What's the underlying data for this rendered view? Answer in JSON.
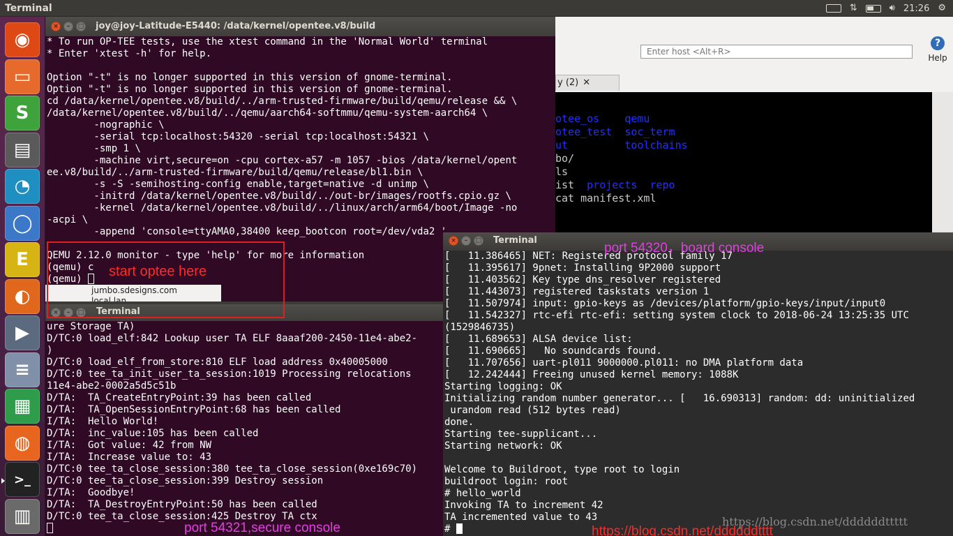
{
  "top_bar": {
    "title": "Terminal",
    "indicators": [
      "keyboard-icon",
      "network-icon",
      "battery-icon",
      "volume-icon"
    ],
    "clock": "21:26"
  },
  "launcher": {
    "items": [
      {
        "name": "ubuntu-dash-icon",
        "color": "#dd4814",
        "glyph": "◉"
      },
      {
        "name": "files-icon",
        "color": "#e66a2c",
        "glyph": "▭"
      },
      {
        "name": "sublime-editor-icon",
        "color": "#3fa33c",
        "glyph": "S"
      },
      {
        "name": "terminal-app-icon",
        "color": "#5a5a5a",
        "glyph": "▤"
      },
      {
        "name": "network-app-icon",
        "color": "#1e8fc0",
        "glyph": "◔"
      },
      {
        "name": "chromium-icon",
        "color": "#3b78c8",
        "glyph": "◯"
      },
      {
        "name": "editor-e-icon",
        "color": "#d6b414",
        "glyph": "E"
      },
      {
        "name": "software-app-icon",
        "color": "#e0681c",
        "glyph": "◐"
      },
      {
        "name": "video-app-icon",
        "color": "#5c6a80",
        "glyph": "▶"
      },
      {
        "name": "stack-app-icon",
        "color": "#8090a8",
        "glyph": "≡"
      },
      {
        "name": "spreadsheet-icon",
        "color": "#2e9c4a",
        "glyph": "▦"
      },
      {
        "name": "firefox-icon",
        "color": "#e86520",
        "glyph": "◍"
      },
      {
        "name": "terminal-icon",
        "color": "#222222",
        "glyph": ">_"
      },
      {
        "name": "workspace-icon",
        "color": "#6a6a6a",
        "glyph": "▥"
      }
    ]
  },
  "bg_window": {
    "host_placeholder": "Enter host <Alt+R>",
    "help_label": "Help",
    "tab_label": "y (2)",
    "terminal_lines": [
      [
        {
          "t": ""
        }
      ],
      [
        {
          "t": "otee_os    ",
          "c": "bl"
        },
        {
          "t": "qemu",
          "c": "bl"
        }
      ],
      [
        {
          "t": "otee_test  ",
          "c": "bl"
        },
        {
          "t": "soc_term",
          "c": "bl"
        }
      ],
      [
        {
          "t": "ut         ",
          "c": "bl"
        },
        {
          "t": "toolchains",
          "c": "bl"
        }
      ],
      [
        {
          "t": "bo/",
          "c": "gr"
        }
      ],
      [
        {
          "t": "ls",
          "c": "gr"
        }
      ],
      [
        {
          "t": "ist  ",
          "c": "gr"
        },
        {
          "t": "projects  ",
          "c": "bl"
        },
        {
          "t": "repo",
          "c": "bl"
        }
      ],
      [
        {
          "t": "cat manifest.xml",
          "c": "gr"
        }
      ]
    ]
  },
  "main_terminal": {
    "title": "joy@joy-Latitude-E5440: /data/kernel/opentee.v8/build",
    "lines": [
      "* To run OP-TEE tests, use the xtest command in the 'Normal World' terminal",
      "* Enter 'xtest -h' for help.",
      "",
      "Option \"-t\" is no longer supported in this version of gnome-terminal.",
      "Option \"-t\" is no longer supported in this version of gnome-terminal.",
      "cd /data/kernel/opentee.v8/build/../arm-trusted-firmware/build/qemu/release && \\",
      "/data/kernel/opentee.v8/build/../qemu/aarch64-softmmu/qemu-system-aarch64 \\",
      "        -nographic \\",
      "        -serial tcp:localhost:54320 -serial tcp:localhost:54321 \\",
      "        -smp 1 \\",
      "        -machine virt,secure=on -cpu cortex-a57 -m 1057 -bios /data/kernel/opent",
      "ee.v8/build/../arm-trusted-firmware/build/qemu/release/bl1.bin \\",
      "        -s -S -semihosting-config enable,target=native -d unimp \\",
      "        -initrd /data/kernel/opentee.v8/build/../out-br/images/rootfs.cpio.gz \\",
      "        -kernel /data/kernel/opentee.v8/build/../linux/arch/arm64/boot/Image -no",
      "-acpi \\",
      "        -append 'console=ttyAMA0,38400 keep_bootcon root=/dev/vda2 '",
      "",
      "QEMU 2.12.0 monitor - type 'help' for more information",
      "(qemu) c",
      "(qemu) "
    ]
  },
  "file_strip": {
    "items": [
      "jumbo.sdesigns.com",
      "local.lan"
    ]
  },
  "secure_terminal": {
    "title": "Terminal",
    "lines": [
      "ure Storage TA)",
      "D/TC:0 load_elf:842 Lookup user TA ELF 8aaaf200-2450-11e4-abe2-",
      ")",
      "D/TC:0 load_elf_from_store:810 ELF load address 0x40005000",
      "D/TC:0 tee_ta_init_user_ta_session:1019 Processing relocations",
      "11e4-abe2-0002a5d5c51b",
      "D/TA:  TA_CreateEntryPoint:39 has been called",
      "D/TA:  TA_OpenSessionEntryPoint:68 has been called",
      "I/TA:  Hello World!",
      "D/TA:  inc_value:105 has been called",
      "I/TA:  Got value: 42 from NW",
      "I/TA:  Increase value to: 43",
      "D/TC:0 tee_ta_close_session:380 tee_ta_close_session(0xe169c70)",
      "D/TC:0 tee_ta_close_session:399 Destroy session",
      "I/TA:  Goodbye!",
      "D/TA:  TA_DestroyEntryPoint:50 has been called",
      "D/TC:0 tee_ta_close_session:425 Destroy TA ctx"
    ]
  },
  "board_terminal": {
    "title": "Terminal",
    "lines": [
      "[   11.386465] NET: Registered protocol family 17",
      "[   11.395617] 9pnet: Installing 9P2000 support",
      "[   11.403562] Key type dns_resolver registered",
      "[   11.443073] registered taskstats version 1",
      "[   11.507974] input: gpio-keys as /devices/platform/gpio-keys/input/input0",
      "[   11.542327] rtc-efi rtc-efi: setting system clock to 2018-06-24 13:25:35 UTC",
      "(1529846735)",
      "[   11.689653] ALSA device list:",
      "[   11.690665]   No soundcards found.",
      "[   11.707656] uart-pl011 9000000.pl011: no DMA platform data",
      "[   12.242444] Freeing unused kernel memory: 1088K",
      "Starting logging: OK",
      "Initializing random number generator... [   16.690313] random: dd: uninitialized",
      " urandom read (512 bytes read)",
      "done.",
      "Starting tee-supplicant...",
      "Starting network: OK",
      "",
      "Welcome to Buildroot, type root to login",
      "buildroot login: root",
      "# hello_world",
      "Invoking TA to increment 42",
      "TA incremented value to 43",
      "# "
    ]
  },
  "annotations": {
    "start_optee": "start optee here",
    "board_console": "port 54320，board console",
    "secure_console": "port 54321,secure console",
    "url": "https://blog.csdn.net/ddddddtttt",
    "watermark": "https://blog.csdn.net/ddddddttttt"
  }
}
